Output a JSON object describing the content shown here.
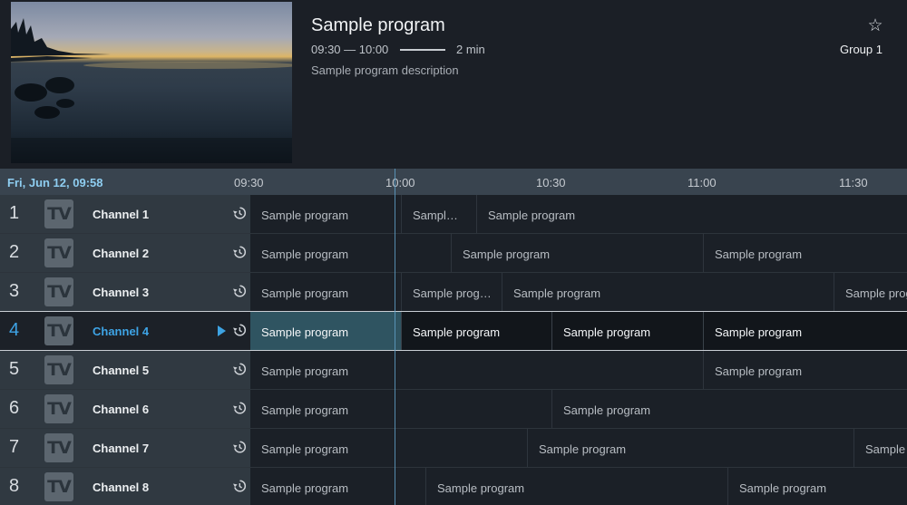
{
  "program": {
    "title": "Sample program",
    "time": "09:30 — 10:00",
    "duration": "2 min",
    "progress": 0.93,
    "description": "Sample program description",
    "group": "Group 1"
  },
  "icons": {
    "favorite": "star-outline-icon",
    "history": "history-icon",
    "playing": "play-icon",
    "channel_logo": "tv-logo-icon"
  },
  "timeline": {
    "date": "Fri, Jun 12, 09:58",
    "ticks": [
      "09:30",
      "10:00",
      "10:30",
      "11:00",
      "11:30"
    ]
  },
  "channels": [
    {
      "number": "1",
      "logo": "TV",
      "name": "Channel 1",
      "programs": [
        "Sample program",
        "Sample program",
        "Sample program"
      ]
    },
    {
      "number": "2",
      "logo": "TV",
      "name": "Channel 2",
      "programs": [
        "Sample program",
        "Sample program",
        "Sample program"
      ]
    },
    {
      "number": "3",
      "logo": "TV",
      "name": "Channel 3",
      "programs": [
        "Sample program",
        "Sample program",
        "Sample program",
        "Sample program"
      ]
    },
    {
      "number": "4",
      "logo": "TV",
      "name": "Channel 4",
      "programs": [
        "Sample program",
        "Sample program",
        "Sample program",
        "Sample program"
      ]
    },
    {
      "number": "5",
      "logo": "TV",
      "name": "Channel 5",
      "programs": [
        "Sample program",
        "Sample program"
      ]
    },
    {
      "number": "6",
      "logo": "TV",
      "name": "Channel 6",
      "programs": [
        "Sample program",
        "Sample program"
      ]
    },
    {
      "number": "7",
      "logo": "TV",
      "name": "Channel 7",
      "programs": [
        "Sample program",
        "Sample program",
        "Sample program"
      ]
    },
    {
      "number": "8",
      "logo": "TV",
      "name": "Channel 8",
      "programs": [
        "Sample program",
        "Sample program",
        "Sample program"
      ]
    }
  ],
  "colors": {
    "accent": "#3ea4e6",
    "date_text": "#8ecdf0",
    "active_program": "#2f5461"
  }
}
